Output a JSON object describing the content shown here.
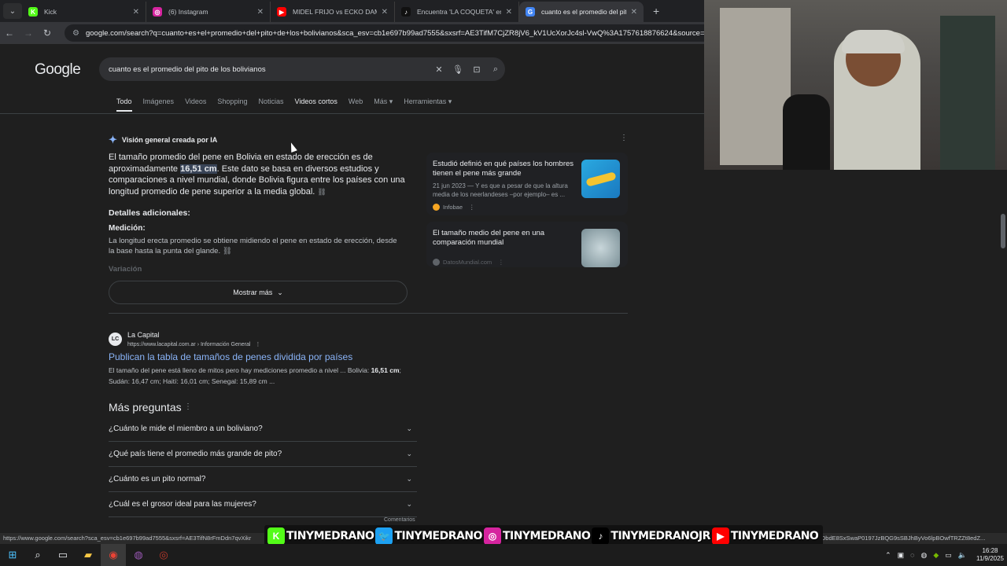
{
  "browser": {
    "tabs": [
      {
        "title": "Kick",
        "fav": "K",
        "color": "#53fc18",
        "active": false
      },
      {
        "title": "(6) Instagram",
        "fav": "◎",
        "color": "#d6249f",
        "active": false
      },
      {
        "title": "MIDEL FRIJO vs ECKO DAM - 4",
        "fav": "▶",
        "color": "#ff0000",
        "active": false
      },
      {
        "title": "Encuentra 'LA COQUETA' en Ti",
        "fav": "♪",
        "color": "#111111",
        "active": false
      },
      {
        "title": "cuanto es el promedio del pito",
        "fav": "G",
        "color": "#4285f4",
        "active": true
      }
    ],
    "new_tab": "+",
    "url": "google.com/search?q=cuanto+es+el+promedio+del+pito+de+los+bolivianos&sca_esv=cb1e697b99ad7555&sxsrf=AE3TifM7CjZR8jV6_kV1UcXorJc4sl-VwQ%3A1757618876624&source=hp&e"
  },
  "google": {
    "logo": "Google",
    "query": "cuanto es el promedio del pito de los bolivianos",
    "tabs": [
      "Todo",
      "Imágenes",
      "Videos",
      "Shopping",
      "Noticias",
      "Videos cortos",
      "Web",
      "Más ▾",
      "Herramientas ▾"
    ]
  },
  "ai_overview": {
    "header": "Visión general creada por IA",
    "text_before": "El tamaño promedio del pene en Bolivia en estado de erección es de aproximadamente ",
    "highlight": "16,51 cm",
    "text_after": ". Este dato se basa en diversos estudios y comparaciones a nivel mundial, donde Bolivia figura entre los países con una longitud promedio de pene superior a la media global.",
    "details_heading": "Detalles adicionales:",
    "measure_heading": "Medición:",
    "measure_text": "La longitud erecta promedio se obtiene midiendo el pene en estado de erección, desde la base hasta la punta del glande.",
    "faded_heading": "Variación",
    "more_button": "Mostrar más",
    "cards": [
      {
        "title": "Estudió definió en qué países los hombres tienen el pene más grande",
        "desc": "21 jun 2023 — Y es que a pesar de que la altura media de los neerlandeses –por ejemplo– es ...",
        "source": "Infobae"
      },
      {
        "title": "El tamaño medio del pene en una comparación mundial",
        "desc": "",
        "source": "DatosMundial.com"
      }
    ]
  },
  "result": {
    "site_name": "La Capital",
    "site_icon": "LC",
    "url": "https://www.lacapital.com.ar › Información General",
    "title": "Publican la tabla de tamaños de penes dividida por países",
    "snippet_before": "El tamaño del pene está lleno de mitos pero hay mediciones promedio a nivel ... Bolivia: ",
    "snippet_bold": "16,51 cm",
    "snippet_after": "; Sudán: 16,47 cm; Haití: 16,01 cm; Senegal: 15,89 cm ..."
  },
  "paa": {
    "heading": "Más preguntas",
    "questions": [
      "¿Cuánto le mide el miembro a un boliviano?",
      "¿Qué país tiene el promedio más grande de pito?",
      "¿Cuánto es un pito normal?",
      "¿Cuál es el grosor ideal para las mujeres?"
    ],
    "comments": "Comentarios"
  },
  "status_url": "https://www.google.com/search?sca_esv=cb1e697b99ad7555&sxsrf=AE3TifN8rFmDdn7qvXikr",
  "status_url_tail": "8llld9pHGh2yQ6AdokkDbdE8SxSwaP0197JzBQG9sSBJhByVo6lpBOwfTRZZt8edZ...",
  "overlay": [
    {
      "icon": "K",
      "color": "#53fc18",
      "name": "TINYMEDRANO"
    },
    {
      "icon": "🐦",
      "color": "#1da1f2",
      "name": "TINYMEDRANO"
    },
    {
      "icon": "◎",
      "color": "#d6249f",
      "name": "TINYMEDRANO"
    },
    {
      "icon": "♪",
      "color": "#000000",
      "name": "TINYMEDRANOJR"
    },
    {
      "icon": "▶",
      "color": "#ff0000",
      "name": "TINYMEDRANO"
    }
  ],
  "taskbar": {
    "time": "16:28",
    "date": "11/9/2025"
  }
}
